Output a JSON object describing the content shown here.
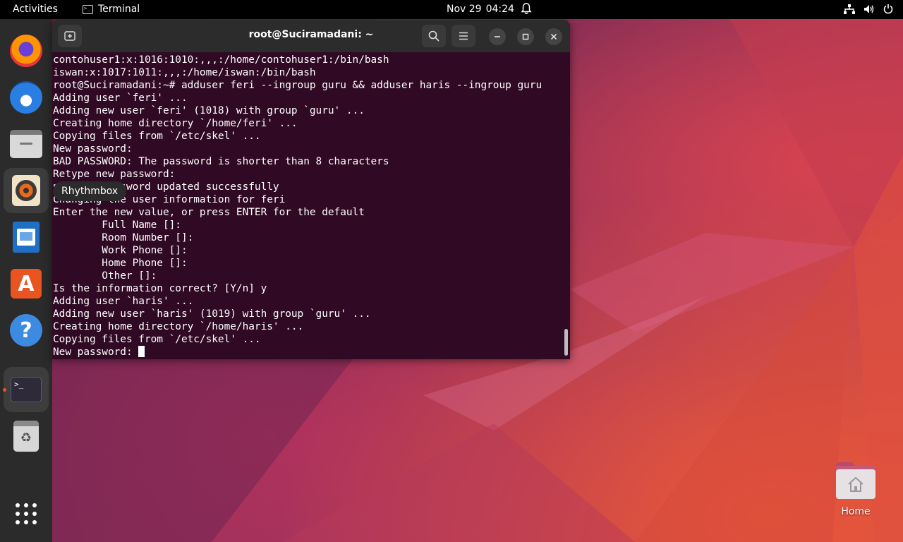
{
  "topbar": {
    "activities": "Activities",
    "app_name": "Terminal",
    "date": "Nov 29",
    "time": "04:24"
  },
  "dock": {
    "items": [
      "Firefox",
      "Thunderbird",
      "Files",
      "Rhythmbox",
      "LibreOffice Writer",
      "Ubuntu Software",
      "Help",
      "Terminal",
      "Trash",
      "Show Applications"
    ],
    "tooltip": "Rhythmbox"
  },
  "terminal": {
    "title": "root@Suciramadani: ~",
    "lines": [
      "contohuser1:x:1016:1010:,,,:/home/contohuser1:/bin/bash",
      "iswan:x:1017:1011:,,,:/home/iswan:/bin/bash",
      "root@Suciramadani:~# adduser feri --ingroup guru && adduser haris --ingroup guru",
      "Adding user `feri' ...",
      "Adding new user `feri' (1018) with group `guru' ...",
      "Creating home directory `/home/feri' ...",
      "Copying files from `/etc/skel' ...",
      "New password:",
      "BAD PASSWORD: The password is shorter than 8 characters",
      "Retype new password:",
      "passwd: password updated successfully",
      "Changing the user information for feri",
      "Enter the new value, or press ENTER for the default",
      "        Full Name []:",
      "        Room Number []:",
      "        Work Phone []:",
      "        Home Phone []:",
      "        Other []:",
      "Is the information correct? [Y/n] y",
      "Adding user `haris' ...",
      "Adding new user `haris' (1019) with group `guru' ...",
      "Creating home directory `/home/haris' ...",
      "Copying files from `/etc/skel' ...",
      "New password: "
    ]
  },
  "desktop": {
    "home_label": "Home"
  },
  "colors": {
    "terminal_bg": "#300a24",
    "accent": "#e95420"
  }
}
